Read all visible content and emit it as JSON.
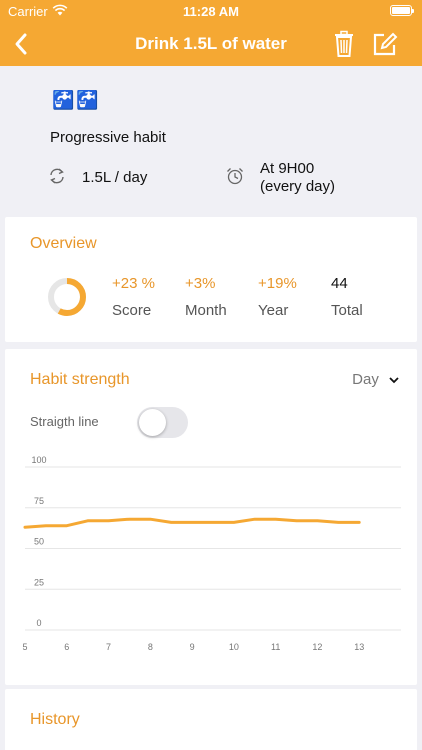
{
  "status": {
    "carrier": "Carrier",
    "time": "11:28 AM"
  },
  "nav": {
    "title": "Drink 1.5L of water"
  },
  "habit": {
    "icons": "🚰🚰",
    "type": "Progressive habit",
    "goal": "1.5L / day",
    "reminder_line1": "At 9H00",
    "reminder_line2": "(every day)"
  },
  "overview": {
    "title": "Overview",
    "score_progress": 0.58,
    "stats": [
      {
        "value": "+23 %",
        "label": "Score"
      },
      {
        "value": "+3%",
        "label": "Month"
      },
      {
        "value": "+19%",
        "label": "Year"
      },
      {
        "value": "44",
        "label": "Total"
      }
    ]
  },
  "strength": {
    "title": "Habit strength",
    "range": "Day",
    "straight_line_label": "Straigth line",
    "straight_line_on": false
  },
  "history": {
    "title": "History"
  },
  "colors": {
    "accent": "#f5a833",
    "accent_text": "#e8962a"
  },
  "chart_data": {
    "type": "line",
    "x": [
      5,
      5.5,
      6,
      6.5,
      7,
      7.5,
      8,
      8.5,
      9,
      9.5,
      10,
      10.5,
      11,
      11.5,
      12,
      12.5,
      13
    ],
    "series": [
      {
        "values": [
          63,
          64,
          64,
          67,
          67,
          68,
          68,
          66,
          66,
          66,
          66,
          68,
          68,
          67,
          67,
          66,
          66
        ]
      }
    ],
    "xticks": [
      5,
      6,
      7,
      8,
      9,
      10,
      11,
      12,
      13
    ],
    "yticks": [
      0,
      25,
      50,
      75,
      100
    ],
    "xlim": [
      5,
      14
    ],
    "ylim": [
      0,
      100
    ],
    "grid": true
  }
}
